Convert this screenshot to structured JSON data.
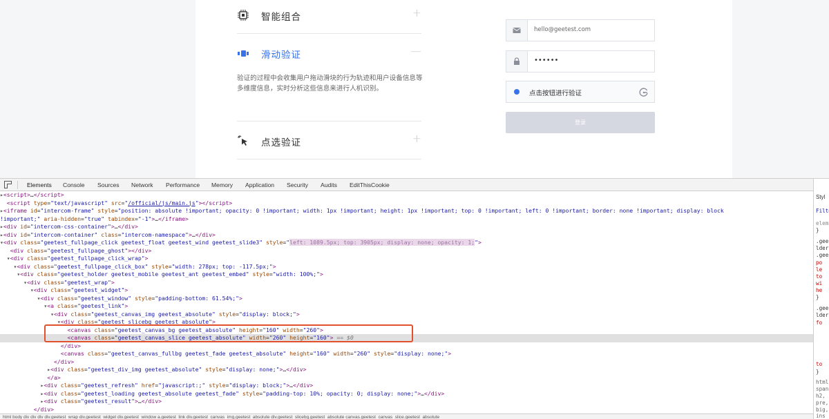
{
  "site": {
    "features": [
      {
        "title": "智能组合",
        "toggle": "+",
        "icon": "chip-icon"
      },
      {
        "title": "滑动验证",
        "toggle": "—",
        "icon": "slider-icon",
        "active": true
      },
      {
        "title": "点选验证",
        "toggle": "+",
        "icon": "click-cursor-icon"
      }
    ],
    "description": "验证的过程中会收集用户拖动滑块的行为轨迹和用户设备信息等多维度信息，实时分析这些信息来进行人机识别。",
    "email_value": "hello@geetest.com",
    "password_value": "••••••",
    "verify_text": "点击按钮进行验证",
    "login_label": "登录",
    "accent_color": "#3873ea"
  },
  "devtools": {
    "tabs": [
      "Elements",
      "Console",
      "Sources",
      "Network",
      "Performance",
      "Memory",
      "Application",
      "Security",
      "Audits",
      "EditThisCookie"
    ],
    "active_tab": "Elements",
    "styles_lines": [
      "Styl",
      "Filte",
      "elem",
      "}",
      ".gee",
      "lder",
      ".gee",
      "po",
      "le",
      "to",
      "wi",
      "he",
      "}",
      ".gee",
      "lder",
      "fo",
      "to",
      "}",
      "html",
      "span",
      "h2,",
      "pre,",
      "big,",
      "ins"
    ],
    "breadcrumb": "html  body  div  div  div  div.geetest_wrap  div.geetest_widget  div.geetest_window  a.geetest_link  div.geetest_canvas_img.geetest_absolute  div.geetest_slicebg.geetest_absolute  canvas.geetest_canvas_slice.geetest_absolute"
  }
}
